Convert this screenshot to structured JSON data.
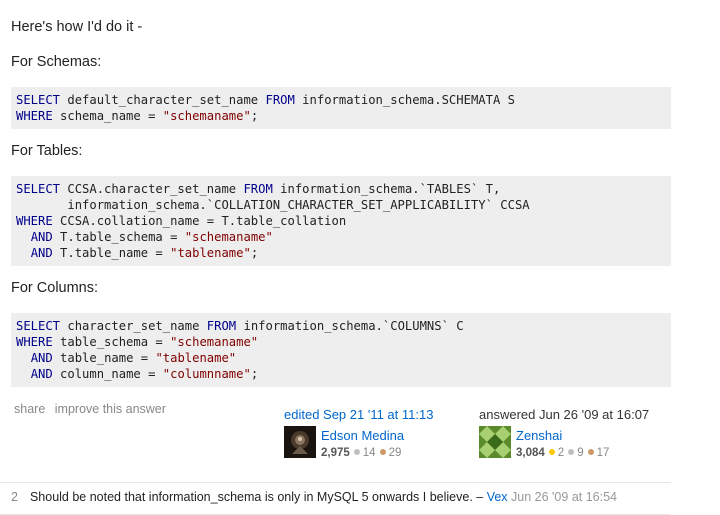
{
  "intro": "Here's how I'd do it -",
  "sections": {
    "schemas_label": "For Schemas:",
    "tables_label": "For Tables:",
    "columns_label": "For Columns:"
  },
  "code": {
    "schemas": [
      [
        {
          "t": "SELECT",
          "k": "kw"
        },
        {
          "t": " default_character_set_name "
        },
        {
          "t": "FROM",
          "k": "kw"
        },
        {
          "t": " information_schema.SCHEMATA S"
        }
      ],
      [
        {
          "t": "WHERE",
          "k": "kw"
        },
        {
          "t": " schema_name = "
        },
        {
          "t": "\"schemaname\"",
          "k": "str"
        },
        {
          "t": ";"
        }
      ]
    ],
    "tables": [
      [
        {
          "t": "SELECT",
          "k": "kw"
        },
        {
          "t": " CCSA.character_set_name "
        },
        {
          "t": "FROM",
          "k": "kw"
        },
        {
          "t": " information_schema.`TABLES` T,"
        }
      ],
      [
        {
          "t": "       information_schema.`COLLATION_CHARACTER_SET_APPLICABILITY` CCSA"
        }
      ],
      [
        {
          "t": "WHERE",
          "k": "kw"
        },
        {
          "t": " CCSA.collation_name = T.table_collation"
        }
      ],
      [
        {
          "t": "  "
        },
        {
          "t": "AND",
          "k": "kw"
        },
        {
          "t": " T.table_schema = "
        },
        {
          "t": "\"schemaname\"",
          "k": "str"
        }
      ],
      [
        {
          "t": "  "
        },
        {
          "t": "AND",
          "k": "kw"
        },
        {
          "t": " T.table_name = "
        },
        {
          "t": "\"tablename\"",
          "k": "str"
        },
        {
          "t": ";"
        }
      ]
    ],
    "columns": [
      [
        {
          "t": "SELECT",
          "k": "kw"
        },
        {
          "t": " character_set_name "
        },
        {
          "t": "FROM",
          "k": "kw"
        },
        {
          "t": " information_schema.`COLUMNS` C"
        }
      ],
      [
        {
          "t": "WHERE",
          "k": "kw"
        },
        {
          "t": " table_schema = "
        },
        {
          "t": "\"schemaname\"",
          "k": "str"
        }
      ],
      [
        {
          "t": "  "
        },
        {
          "t": "AND",
          "k": "kw"
        },
        {
          "t": " table_name = "
        },
        {
          "t": "\"tablename\"",
          "k": "str"
        }
      ],
      [
        {
          "t": "  "
        },
        {
          "t": "AND",
          "k": "kw"
        },
        {
          "t": " column_name = "
        },
        {
          "t": "\"columnname\"",
          "k": "str"
        },
        {
          "t": ";"
        }
      ]
    ]
  },
  "post_menu": {
    "share": "share",
    "improve": "improve this answer"
  },
  "editor": {
    "action": "edited Sep 21 '11 at 11:13",
    "name": "Edson Medina",
    "rep": "2,975",
    "silver": "14",
    "bronze": "29"
  },
  "answerer": {
    "action": "answered Jun 26 '09 at 16:07",
    "name": "Zenshai",
    "rep": "3,084",
    "gold": "2",
    "silver": "9",
    "bronze": "17"
  },
  "comment": {
    "score": "2",
    "text": "Should be noted that information_schema is only in MySQL 5 onwards I believe. –",
    "user": "Vex",
    "date": "Jun 26 '09 at 16:54"
  },
  "colors": {
    "link": "#0066cc",
    "code_bg": "#eeeeee",
    "keyword": "#00008b",
    "string": "#800000"
  }
}
